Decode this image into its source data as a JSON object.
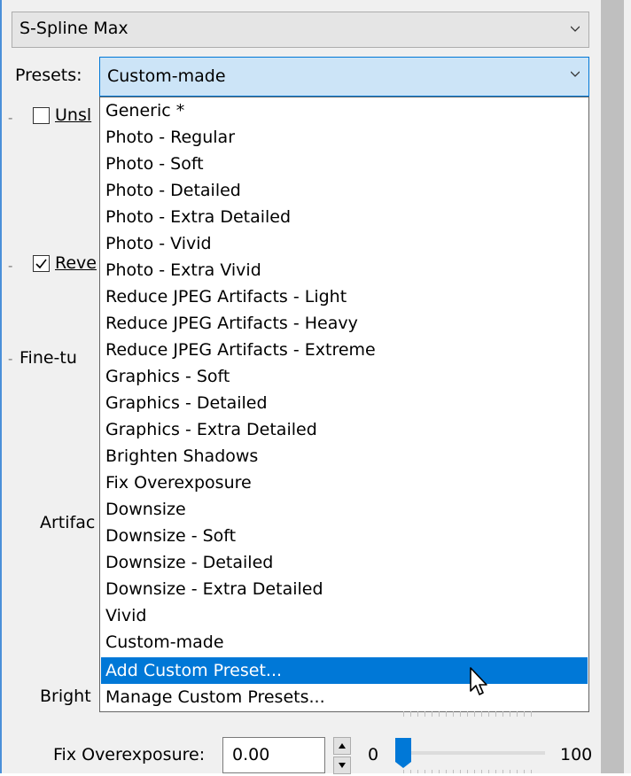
{
  "algorithm": {
    "value": "S-Spline Max"
  },
  "presets": {
    "label": "Presets:",
    "value": "Custom-made",
    "options": [
      "Generic *",
      "Photo - Regular",
      "Photo - Soft",
      "Photo - Detailed",
      "Photo - Extra Detailed",
      "Photo - Vivid",
      "Photo - Extra Vivid",
      "Reduce JPEG Artifacts - Light",
      "Reduce JPEG Artifacts - Heavy",
      "Reduce JPEG Artifacts - Extreme",
      "Graphics - Soft",
      "Graphics - Detailed",
      "Graphics - Extra Detailed",
      "Brighten Shadows",
      "Fix Overexposure",
      "Downsize",
      "Downsize - Soft",
      "Downsize - Detailed",
      "Downsize - Extra Detailed",
      "Vivid",
      "Custom-made",
      "Add Custom Preset...",
      "Manage Custom Presets..."
    ],
    "highlighted": "Add Custom Preset..."
  },
  "background_labels": {
    "unsharp_mask": "Unsl",
    "reverse": "Reve",
    "fine_tune": "Fine-tu",
    "artifacts": "Artifac",
    "brighten": "Bright"
  },
  "checkboxes": {
    "unsharp_checked": false,
    "reverse_checked": true
  },
  "fix_overexposure": {
    "label": "Fix Overexposure:",
    "value": "0.00",
    "min": "0",
    "max": "100",
    "level": 0
  },
  "icons": {
    "chevron": "chevron-down-icon",
    "cursor": "mouse-pointer-icon"
  },
  "colors": {
    "accent": "#0078d7",
    "highlight_bg": "#cce4f7"
  }
}
